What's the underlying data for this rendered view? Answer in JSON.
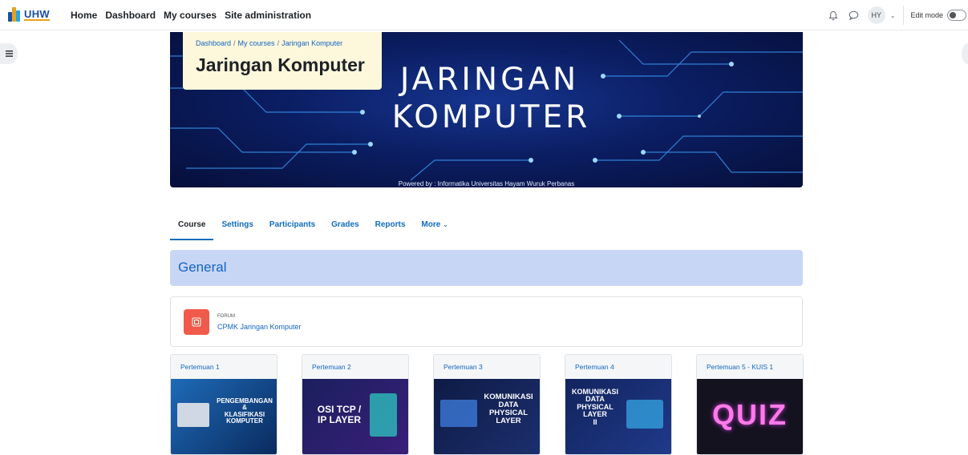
{
  "brand": {
    "name": "UHW"
  },
  "nav": [
    "Home",
    "Dashboard",
    "My courses",
    "Site administration"
  ],
  "user": {
    "initials": "HY",
    "edit_mode_label": "Edit mode"
  },
  "banner": {
    "title_line1": "JARINGAN",
    "title_line2": "KOMPUTER",
    "powered_by": "Powered by : Informatika Universitas Hayam Wuruk Perbanas"
  },
  "breadcrumb": [
    "Dashboard",
    "My courses",
    "Jaringan Komputer"
  ],
  "course_title": "Jaringan Komputer",
  "tabs": [
    "Course",
    "Settings",
    "Participants",
    "Grades",
    "Reports",
    "More"
  ],
  "section_title": "General",
  "activity": {
    "type": "FORUM",
    "name": "CPMK Jaringan Komputer"
  },
  "cards": [
    {
      "title": "Pertemuan 1",
      "image_text": [
        "PENGEMBANGAN",
        "&",
        "KLASIFIKASI",
        "KOMPUTER"
      ]
    },
    {
      "title": "Pertemuan 2",
      "image_text": [
        "OSI TCP /",
        "IP LAYER"
      ]
    },
    {
      "title": "Pertemuan 3",
      "image_text": [
        "KOMUNIKASI",
        "DATA",
        "PHYSICAL",
        "LAYER"
      ]
    },
    {
      "title": "Pertemuan 4",
      "image_text": [
        "KOMUNIKASI",
        "DATA",
        "PHYSICAL",
        "LAYER",
        "II"
      ]
    },
    {
      "title": "Pertemuan 5 - KUIS 1",
      "image_text": [
        "QUIZ"
      ]
    }
  ],
  "colors": {
    "accent": "#0f6cbf",
    "section_bg": "#c8d6f5",
    "header_card_bg": "#fdf7dc",
    "forum_icon": "#f05a4a"
  }
}
